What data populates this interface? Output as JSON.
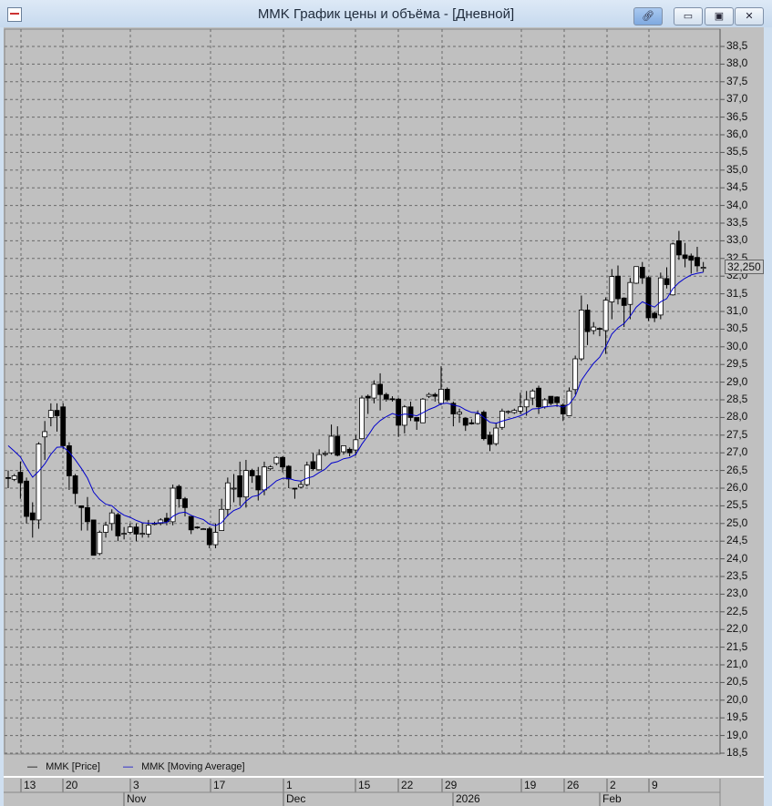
{
  "window": {
    "title": "MMK График цены и объёма - [Дневной]",
    "buttons": {
      "link": "link-icon",
      "minimize": "minimize-icon",
      "restore": "restore-icon",
      "close": "close-icon"
    }
  },
  "legend": [
    {
      "label": "MMK [Price]",
      "color": "#000000"
    },
    {
      "label": "MMK [Moving Average]",
      "color": "#0000cc"
    }
  ],
  "last_price_label": "32,250",
  "chart_data": {
    "type": "candlestick",
    "title": "MMK График цены и объёма - [Дневной]",
    "ylim": [
      18.5,
      38.5
    ],
    "y_ticks": [
      "38,5",
      "38,0",
      "37,5",
      "37,0",
      "36,5",
      "36,0",
      "35,5",
      "35,0",
      "34,5",
      "34,0",
      "33,5",
      "33,0",
      "32,5",
      "32,0",
      "31,5",
      "31,0",
      "30,5",
      "30,0",
      "29,5",
      "29,0",
      "28,5",
      "28,0",
      "27,5",
      "27,0",
      "26,5",
      "26,0",
      "25,5",
      "25,0",
      "24,5",
      "24,0",
      "23,5",
      "23,0",
      "22,5",
      "22,0",
      "21,5",
      "21,0",
      "20,5",
      "20,0",
      "19,5",
      "19,0",
      "18,5"
    ],
    "x_day_ticks": [
      "13",
      "20",
      "3",
      "17",
      "1",
      "15",
      "22",
      "29",
      "19",
      "26",
      "2",
      "9"
    ],
    "x_month_ticks": [
      "Nov",
      "Dec",
      "2026",
      "Feb"
    ],
    "grid": true,
    "legend_position": "bottom-left",
    "moving_average": {
      "type": "exponential",
      "period": 10,
      "initial": 27.2
    },
    "ohlc_fields": [
      "open",
      "high",
      "low",
      "close"
    ],
    "ohlc": [
      [
        26.3,
        26.5,
        26.0,
        26.28
      ],
      [
        26.25,
        26.4,
        26.2,
        26.35
      ],
      [
        26.45,
        26.75,
        25.7,
        26.15
      ],
      [
        26.2,
        26.3,
        25.0,
        25.2
      ],
      [
        25.3,
        25.6,
        24.6,
        25.1
      ],
      [
        25.1,
        27.3,
        24.85,
        27.25
      ],
      [
        27.45,
        27.9,
        26.8,
        27.6
      ],
      [
        28.0,
        28.4,
        27.75,
        28.2
      ],
      [
        28.2,
        28.4,
        27.6,
        28.05
      ],
      [
        28.3,
        28.4,
        27.1,
        27.2
      ],
      [
        27.2,
        27.3,
        25.95,
        26.35
      ],
      [
        26.35,
        26.4,
        25.55,
        25.85
      ],
      [
        25.5,
        25.5,
        24.8,
        25.45
      ],
      [
        25.45,
        25.75,
        24.8,
        25.05
      ],
      [
        25.1,
        25.1,
        24.1,
        24.1
      ],
      [
        24.15,
        24.8,
        24.1,
        24.75
      ],
      [
        24.75,
        25.05,
        24.6,
        24.95
      ],
      [
        25.0,
        25.4,
        24.8,
        25.3
      ],
      [
        25.25,
        25.3,
        24.5,
        24.65
      ],
      [
        24.7,
        24.9,
        24.55,
        24.72
      ],
      [
        24.75,
        25.0,
        24.7,
        24.9
      ],
      [
        24.9,
        25.0,
        24.5,
        24.7
      ],
      [
        24.7,
        25.0,
        24.6,
        24.72
      ],
      [
        24.7,
        25.1,
        24.6,
        24.95
      ],
      [
        25.0,
        25.05,
        24.95,
        25.0
      ],
      [
        25.0,
        25.15,
        24.95,
        25.1
      ],
      [
        25.15,
        25.3,
        24.95,
        25.05
      ],
      [
        25.05,
        26.1,
        24.95,
        26.0
      ],
      [
        26.05,
        26.1,
        25.45,
        25.7
      ],
      [
        25.7,
        25.75,
        25.2,
        25.45
      ],
      [
        25.2,
        25.2,
        24.7,
        24.82
      ],
      [
        24.9,
        24.92,
        24.85,
        24.88
      ],
      [
        24.85,
        24.87,
        24.83,
        24.85
      ],
      [
        24.85,
        24.9,
        24.3,
        24.4
      ],
      [
        24.4,
        25.0,
        24.3,
        24.75
      ],
      [
        24.8,
        25.7,
        24.8,
        25.4
      ],
      [
        25.4,
        26.3,
        25.2,
        26.15
      ],
      [
        26.0,
        26.4,
        25.6,
        26.0
      ],
      [
        26.35,
        26.75,
        25.5,
        25.75
      ],
      [
        25.75,
        26.8,
        25.45,
        26.5
      ],
      [
        26.5,
        26.55,
        26.15,
        26.35
      ],
      [
        26.35,
        26.6,
        25.65,
        25.95
      ],
      [
        25.95,
        26.75,
        25.8,
        26.6
      ],
      [
        26.55,
        26.65,
        26.5,
        26.6
      ],
      [
        26.7,
        26.9,
        26.65,
        26.87
      ],
      [
        26.87,
        26.9,
        26.45,
        26.6
      ],
      [
        26.62,
        26.65,
        26.0,
        26.26
      ],
      [
        26.0,
        26.0,
        25.7,
        25.98
      ],
      [
        26.03,
        26.2,
        26.0,
        26.1
      ],
      [
        26.1,
        26.75,
        26.05,
        26.65
      ],
      [
        26.75,
        27.0,
        26.5,
        26.55
      ],
      [
        26.52,
        27.1,
        26.5,
        26.95
      ],
      [
        26.97,
        27.05,
        26.9,
        26.98
      ],
      [
        27.0,
        27.8,
        26.95,
        27.47
      ],
      [
        27.47,
        27.75,
        26.9,
        26.93
      ],
      [
        27.03,
        27.2,
        26.95,
        27.2
      ],
      [
        27.1,
        27.15,
        26.9,
        27.0
      ],
      [
        27.08,
        27.5,
        26.93,
        27.37
      ],
      [
        27.4,
        28.62,
        27.38,
        28.55
      ],
      [
        28.6,
        28.65,
        28.1,
        28.55
      ],
      [
        28.55,
        29.05,
        28.4,
        28.94
      ],
      [
        28.94,
        29.25,
        28.2,
        28.65
      ],
      [
        28.65,
        28.7,
        28.45,
        28.52
      ],
      [
        28.53,
        28.6,
        28.45,
        28.52
      ],
      [
        28.52,
        28.55,
        27.45,
        27.78
      ],
      [
        27.78,
        28.35,
        27.55,
        28.3
      ],
      [
        28.3,
        28.45,
        27.9,
        28.0
      ],
      [
        28.0,
        28.0,
        27.65,
        27.9
      ],
      [
        27.85,
        28.55,
        27.85,
        28.52
      ],
      [
        28.6,
        28.7,
        28.55,
        28.65
      ],
      [
        28.65,
        28.7,
        28.45,
        28.6
      ],
      [
        28.4,
        29.45,
        28.35,
        28.8
      ],
      [
        28.8,
        28.85,
        28.45,
        28.5
      ],
      [
        28.4,
        28.45,
        27.75,
        28.1
      ],
      [
        28.1,
        28.25,
        27.85,
        28.15
      ],
      [
        27.98,
        28.0,
        27.62,
        27.78
      ],
      [
        27.85,
        27.95,
        27.8,
        27.82
      ],
      [
        27.83,
        28.2,
        27.8,
        28.1
      ],
      [
        28.15,
        28.2,
        27.35,
        27.4
      ],
      [
        27.5,
        27.6,
        27.05,
        27.24
      ],
      [
        27.26,
        27.85,
        27.2,
        27.7
      ],
      [
        27.72,
        28.25,
        27.65,
        28.18
      ],
      [
        28.15,
        28.2,
        28.1,
        28.17
      ],
      [
        28.14,
        28.25,
        28.1,
        28.2
      ],
      [
        28.18,
        28.7,
        28.1,
        28.3
      ],
      [
        28.3,
        28.75,
        28.05,
        28.5
      ],
      [
        28.55,
        28.8,
        28.35,
        28.75
      ],
      [
        28.83,
        28.9,
        28.1,
        28.3
      ],
      [
        28.3,
        28.55,
        28.25,
        28.5
      ],
      [
        28.6,
        28.6,
        28.35,
        28.4
      ],
      [
        28.58,
        28.6,
        28.3,
        28.42
      ],
      [
        28.35,
        28.4,
        27.9,
        28.1
      ],
      [
        28.05,
        28.85,
        28.05,
        28.75
      ],
      [
        28.79,
        29.75,
        28.65,
        29.66
      ],
      [
        29.66,
        31.45,
        29.6,
        31.04
      ],
      [
        31.04,
        31.2,
        30.05,
        30.43
      ],
      [
        30.46,
        30.7,
        30.35,
        30.56
      ],
      [
        30.52,
        30.55,
        30.3,
        30.5
      ],
      [
        30.46,
        31.4,
        29.8,
        31.32
      ],
      [
        31.27,
        32.2,
        30.78,
        31.99
      ],
      [
        32.0,
        32.3,
        31.2,
        31.36
      ],
      [
        31.38,
        31.4,
        30.56,
        31.17
      ],
      [
        31.2,
        31.95,
        30.78,
        31.82
      ],
      [
        31.8,
        32.27,
        31.78,
        32.27
      ],
      [
        32.25,
        32.4,
        31.78,
        31.95
      ],
      [
        31.96,
        32.0,
        30.73,
        30.82
      ],
      [
        30.95,
        31.0,
        30.7,
        30.82
      ],
      [
        30.9,
        32.1,
        30.78,
        31.95
      ],
      [
        31.93,
        32.25,
        31.65,
        31.76
      ],
      [
        31.47,
        32.95,
        31.45,
        32.91
      ],
      [
        33.0,
        33.28,
        32.46,
        32.6
      ],
      [
        32.6,
        32.94,
        32.25,
        32.5
      ],
      [
        32.57,
        32.64,
        32.07,
        32.45
      ],
      [
        32.53,
        32.83,
        32.12,
        32.29
      ],
      [
        32.22,
        32.4,
        32.12,
        32.25
      ]
    ]
  }
}
